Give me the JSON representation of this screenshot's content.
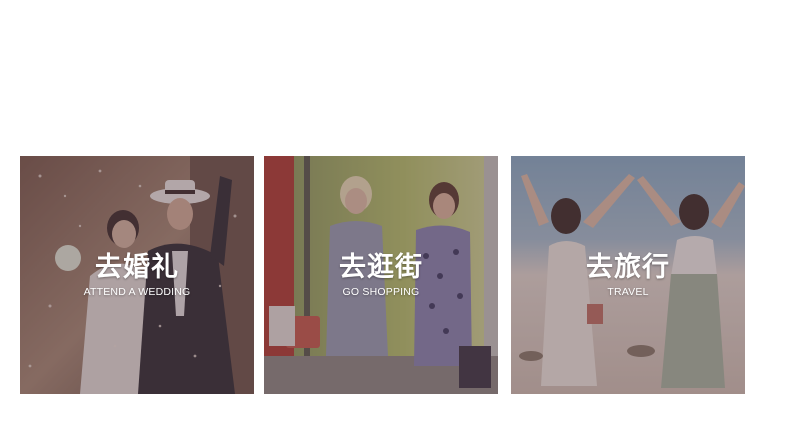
{
  "cards": [
    {
      "title": "去婚礼",
      "subtitle": "ATTEND A WEDDING"
    },
    {
      "title": "去逛街",
      "subtitle": "GO SHOPPING"
    },
    {
      "title": "去旅行",
      "subtitle": "TRAVEL"
    }
  ],
  "colors": {
    "background": "#ffffff",
    "overlay": "#503746",
    "caption_text": "#ffffff"
  }
}
